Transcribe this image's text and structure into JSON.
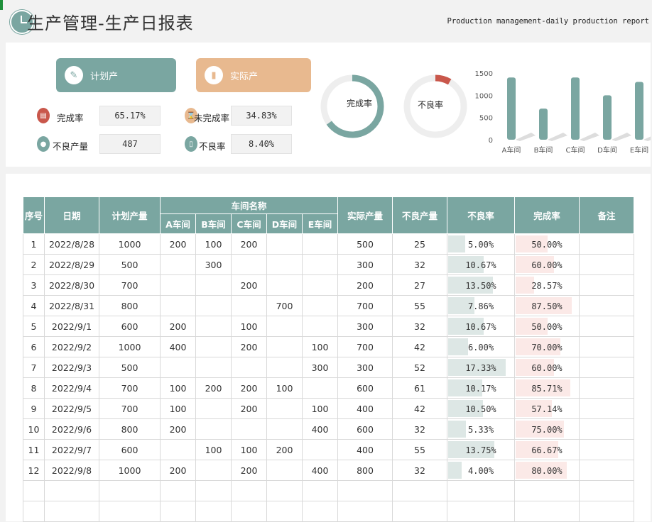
{
  "header": {
    "title": "生产管理-生产日报表",
    "subtitle": "Production management-daily production report",
    "clock_icon": "clock-icon"
  },
  "colors": {
    "teal": "#7aa6a1",
    "peach": "#e8b98f",
    "red": "#c9574b",
    "bad_bar": "#dde7e5",
    "done_bar": "#fbe9e7"
  },
  "dashboard": {
    "plan_label": "计划产",
    "actual_label": "实际产",
    "kpis": [
      {
        "label": "完成率",
        "value": "65.17%"
      },
      {
        "label": "未完成率",
        "value": "34.83%"
      },
      {
        "label": "不良产量",
        "value": "487"
      },
      {
        "label": "不良率",
        "value": "8.40%"
      }
    ],
    "gauges": [
      {
        "label": "完成率",
        "fraction": 0.6517
      },
      {
        "label": "不良率",
        "fraction": 0.084
      }
    ]
  },
  "chart_data": {
    "type": "bar",
    "categories": [
      "A车间",
      "B车间",
      "C车间",
      "D车间",
      "E车间"
    ],
    "values": [
      1400,
      700,
      1400,
      1000,
      1300
    ],
    "yticks": [
      "1500",
      "1000",
      "500",
      "0"
    ],
    "ylim": [
      0,
      1500
    ]
  },
  "table": {
    "headers": {
      "seq": "序号",
      "date": "日期",
      "plan": "计划产量",
      "workshop_group": "车间名称",
      "a": "A车间",
      "b": "B车间",
      "c": "C车间",
      "d": "D车间",
      "e": "E车间",
      "actual": "实际产量",
      "bad": "不良产量",
      "bad_rate": "不良率",
      "done_rate": "完成率",
      "remark": "备注"
    },
    "rows": [
      {
        "seq": "1",
        "date": "2022/8/28",
        "plan": "1000",
        "a": "200",
        "b": "100",
        "c": "200",
        "d": "",
        "e": "",
        "actual": "500",
        "bad": "25",
        "bad_rate": "5.00%",
        "bad_f": 0.05,
        "done_rate": "50.00%",
        "done_f": 0.5
      },
      {
        "seq": "2",
        "date": "2022/8/29",
        "plan": "500",
        "a": "",
        "b": "300",
        "c": "",
        "d": "",
        "e": "",
        "actual": "300",
        "bad": "32",
        "bad_rate": "10.67%",
        "bad_f": 0.1067,
        "done_rate": "60.00%",
        "done_f": 0.6
      },
      {
        "seq": "3",
        "date": "2022/8/30",
        "plan": "700",
        "a": "",
        "b": "",
        "c": "200",
        "d": "",
        "e": "",
        "actual": "200",
        "bad": "27",
        "bad_rate": "13.50%",
        "bad_f": 0.135,
        "done_rate": "28.57%",
        "done_f": 0.2857
      },
      {
        "seq": "4",
        "date": "2022/8/31",
        "plan": "800",
        "a": "",
        "b": "",
        "c": "",
        "d": "700",
        "e": "",
        "actual": "700",
        "bad": "55",
        "bad_rate": "7.86%",
        "bad_f": 0.0786,
        "done_rate": "87.50%",
        "done_f": 0.875
      },
      {
        "seq": "5",
        "date": "2022/9/1",
        "plan": "600",
        "a": "200",
        "b": "",
        "c": "100",
        "d": "",
        "e": "",
        "actual": "300",
        "bad": "32",
        "bad_rate": "10.67%",
        "bad_f": 0.1067,
        "done_rate": "50.00%",
        "done_f": 0.5
      },
      {
        "seq": "6",
        "date": "2022/9/2",
        "plan": "1000",
        "a": "400",
        "b": "",
        "c": "200",
        "d": "",
        "e": "100",
        "actual": "700",
        "bad": "42",
        "bad_rate": "6.00%",
        "bad_f": 0.06,
        "done_rate": "70.00%",
        "done_f": 0.7
      },
      {
        "seq": "7",
        "date": "2022/9/3",
        "plan": "500",
        "a": "",
        "b": "",
        "c": "",
        "d": "",
        "e": "300",
        "actual": "300",
        "bad": "52",
        "bad_rate": "17.33%",
        "bad_f": 0.1733,
        "done_rate": "60.00%",
        "done_f": 0.6
      },
      {
        "seq": "8",
        "date": "2022/9/4",
        "plan": "700",
        "a": "100",
        "b": "200",
        "c": "200",
        "d": "100",
        "e": "",
        "actual": "600",
        "bad": "61",
        "bad_rate": "10.17%",
        "bad_f": 0.1017,
        "done_rate": "85.71%",
        "done_f": 0.8571
      },
      {
        "seq": "9",
        "date": "2022/9/5",
        "plan": "700",
        "a": "100",
        "b": "",
        "c": "200",
        "d": "",
        "e": "100",
        "actual": "400",
        "bad": "42",
        "bad_rate": "10.50%",
        "bad_f": 0.105,
        "done_rate": "57.14%",
        "done_f": 0.5714
      },
      {
        "seq": "10",
        "date": "2022/9/6",
        "plan": "800",
        "a": "200",
        "b": "",
        "c": "",
        "d": "",
        "e": "400",
        "actual": "600",
        "bad": "32",
        "bad_rate": "5.33%",
        "bad_f": 0.0533,
        "done_rate": "75.00%",
        "done_f": 0.75
      },
      {
        "seq": "11",
        "date": "2022/9/7",
        "plan": "600",
        "a": "",
        "b": "100",
        "c": "100",
        "d": "200",
        "e": "",
        "actual": "400",
        "bad": "55",
        "bad_rate": "13.75%",
        "bad_f": 0.1375,
        "done_rate": "66.67%",
        "done_f": 0.6667
      },
      {
        "seq": "12",
        "date": "2022/9/8",
        "plan": "1000",
        "a": "200",
        "b": "",
        "c": "200",
        "d": "",
        "e": "400",
        "actual": "800",
        "bad": "32",
        "bad_rate": "4.00%",
        "bad_f": 0.04,
        "done_rate": "80.00%",
        "done_f": 0.8
      }
    ]
  }
}
